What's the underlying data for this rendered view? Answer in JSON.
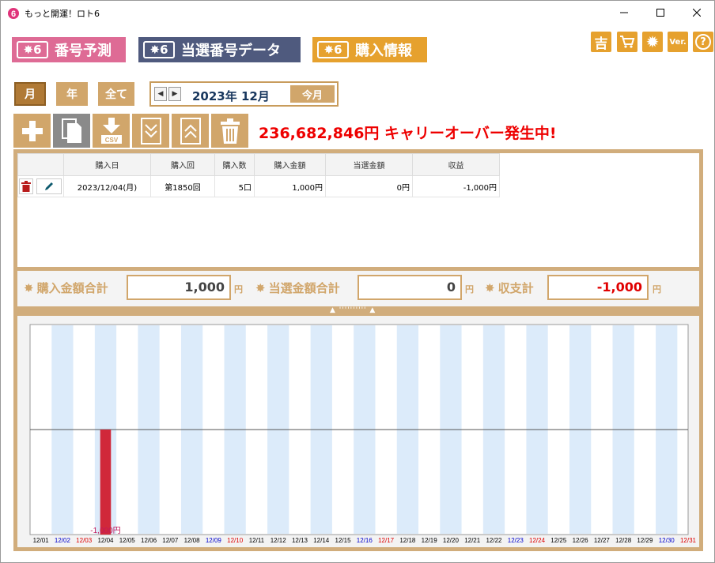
{
  "window": {
    "title": "もっと開運！ロト6"
  },
  "nav": {
    "tabs": [
      {
        "label": "番号予測",
        "badge": "6",
        "color": "#de6b95"
      },
      {
        "label": "当選番号データ",
        "badge": "6",
        "color": "#4f5a7e"
      },
      {
        "label": "購入情報",
        "badge": "6",
        "color": "#e6a12e"
      }
    ],
    "right_icons": [
      {
        "name": "kichi-icon",
        "text": "吉"
      },
      {
        "name": "cart-icon",
        "text": ""
      },
      {
        "name": "gear-icon",
        "text": ""
      },
      {
        "name": "version-icon",
        "text": "Ver."
      },
      {
        "name": "help-icon",
        "text": "?"
      }
    ]
  },
  "period": {
    "buttons": [
      "月",
      "年",
      "全て"
    ],
    "active": "月",
    "current_label": "2023年 12月",
    "today_label": "今月"
  },
  "toolbar": {
    "csv_label": "CSV",
    "carryover_text": "236,682,846円 キャリーオーバー発生中!"
  },
  "table": {
    "headers": [
      "購入日",
      "購入回",
      "購入数",
      "購入金額",
      "当選金額",
      "収益"
    ],
    "rows": [
      {
        "date": "2023/12/04(月)",
        "round": "第1850回",
        "count": "5口",
        "amount": "1,000円",
        "winnings": "0円",
        "profit": "-1,000円"
      }
    ]
  },
  "totals": {
    "purchase_label": "購入金額合計",
    "purchase_value": "1,000",
    "winning_label": "当選金額合計",
    "winning_value": "0",
    "balance_label": "収支計",
    "balance_value": "-1,000",
    "unit": "円"
  },
  "splitter": {
    "label": "▲ '''''''''' ▲"
  },
  "colors": {
    "accent": "#d1a66b",
    "bar": "#d0283a",
    "saturday": "#0000cc",
    "sunday": "#dd0000"
  },
  "chart_data": {
    "type": "bar",
    "categories": [
      "12/01",
      "12/02",
      "12/03",
      "12/04",
      "12/05",
      "12/06",
      "12/07",
      "12/08",
      "12/09",
      "12/10",
      "12/11",
      "12/12",
      "12/13",
      "12/14",
      "12/15",
      "12/16",
      "12/17",
      "12/18",
      "12/19",
      "12/20",
      "12/21",
      "12/22",
      "12/23",
      "12/24",
      "12/25",
      "12/26",
      "12/27",
      "12/28",
      "12/29",
      "12/30",
      "12/31"
    ],
    "values": [
      0,
      0,
      0,
      -1000,
      0,
      0,
      0,
      0,
      0,
      0,
      0,
      0,
      0,
      0,
      0,
      0,
      0,
      0,
      0,
      0,
      0,
      0,
      0,
      0,
      0,
      0,
      0,
      0,
      0,
      0,
      0
    ],
    "data_labels": [
      {
        "index": 3,
        "text": "-1,000円"
      }
    ],
    "saturdays": [
      1,
      8,
      15,
      22,
      29
    ],
    "sundays": [
      2,
      9,
      16,
      23,
      30
    ],
    "ylim": [
      -1000,
      1000
    ],
    "xlabel": "",
    "ylabel": "",
    "title": ""
  }
}
